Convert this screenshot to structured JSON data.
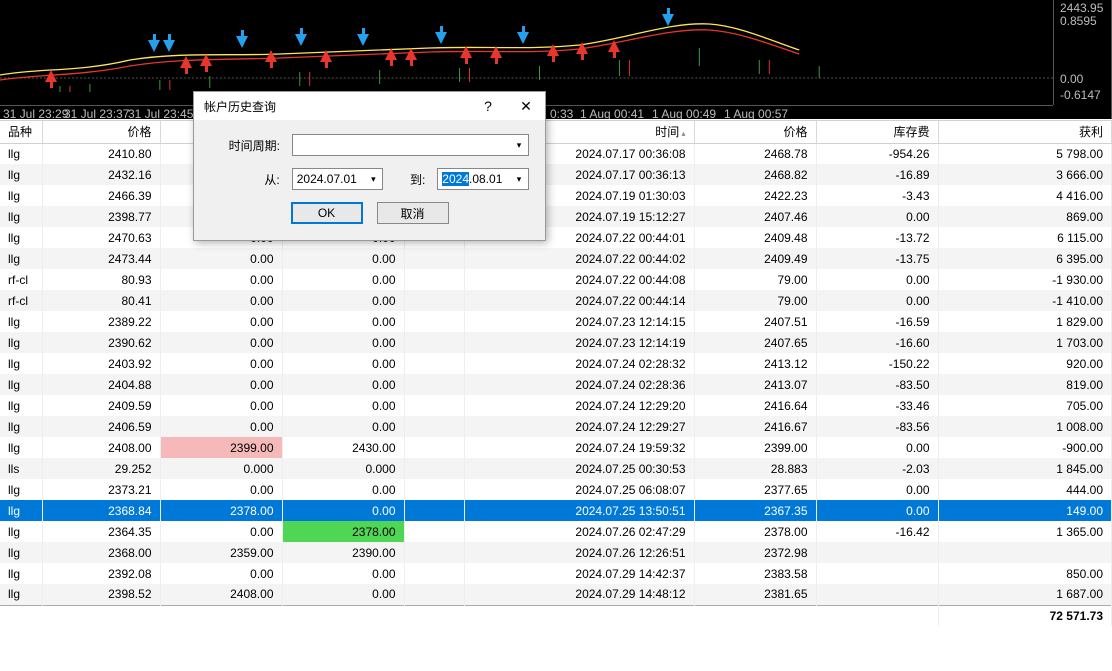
{
  "chart": {
    "scale": [
      "2443.95",
      "0.8595",
      "0.00",
      "-0.6147"
    ],
    "tlabels": [
      "31 Jul 23:29",
      "31 Jul 23:37",
      "31 Jul 23:45",
      "0:33",
      "1 Aug 00:41",
      "1 Aug 00:49",
      "1 Aug 00:57"
    ]
  },
  "dialog": {
    "title": "帐户历史查询",
    "period_label": "时间周期:",
    "from_label": "从:",
    "to_label": "到:",
    "from": "2024.07.01",
    "to": "2024.08.01",
    "to_sel": "2024",
    "ok": "OK",
    "cancel": "取消"
  },
  "grid": {
    "headers": [
      "品种",
      "价格",
      "",
      "",
      "",
      "时间",
      "价格",
      "库存费",
      "获利"
    ],
    "rows": [
      {
        "c": [
          "llg",
          "2410.80",
          "",
          "",
          "",
          "2024.07.17 00:36:08",
          "2468.78",
          "-954.26",
          "5 798.00"
        ]
      },
      {
        "c": [
          "llg",
          "2432.16",
          "",
          "",
          "",
          "2024.07.17 00:36:13",
          "2468.82",
          "-16.89",
          "3 666.00"
        ]
      },
      {
        "c": [
          "llg",
          "2466.39",
          "",
          "",
          "",
          "2024.07.19 01:30:03",
          "2422.23",
          "-3.43",
          "4 416.00"
        ]
      },
      {
        "c": [
          "llg",
          "2398.77",
          "",
          "",
          "",
          "2024.07.19 15:12:27",
          "2407.46",
          "0.00",
          "869.00"
        ]
      },
      {
        "c": [
          "llg",
          "2470.63",
          "0.00",
          "0.00",
          "",
          "2024.07.22 00:44:01",
          "2409.48",
          "-13.72",
          "6 115.00"
        ]
      },
      {
        "c": [
          "llg",
          "2473.44",
          "0.00",
          "0.00",
          "",
          "2024.07.22 00:44:02",
          "2409.49",
          "-13.75",
          "6 395.00"
        ]
      },
      {
        "c": [
          "rf-cl",
          "80.93",
          "0.00",
          "0.00",
          "",
          "2024.07.22 00:44:08",
          "79.00",
          "0.00",
          "-1 930.00"
        ]
      },
      {
        "c": [
          "rf-cl",
          "80.41",
          "0.00",
          "0.00",
          "",
          "2024.07.22 00:44:14",
          "79.00",
          "0.00",
          "-1 410.00"
        ]
      },
      {
        "c": [
          "llg",
          "2389.22",
          "0.00",
          "0.00",
          "",
          "2024.07.23 12:14:15",
          "2407.51",
          "-16.59",
          "1 829.00"
        ]
      },
      {
        "c": [
          "llg",
          "2390.62",
          "0.00",
          "0.00",
          "",
          "2024.07.23 12:14:19",
          "2407.65",
          "-16.60",
          "1 703.00"
        ]
      },
      {
        "c": [
          "llg",
          "2403.92",
          "0.00",
          "0.00",
          "",
          "2024.07.24 02:28:32",
          "2413.12",
          "-150.22",
          "920.00"
        ]
      },
      {
        "c": [
          "llg",
          "2404.88",
          "0.00",
          "0.00",
          "",
          "2024.07.24 02:28:36",
          "2413.07",
          "-83.50",
          "819.00"
        ]
      },
      {
        "c": [
          "llg",
          "2409.59",
          "0.00",
          "0.00",
          "",
          "2024.07.24 12:29:20",
          "2416.64",
          "-33.46",
          "705.00"
        ]
      },
      {
        "c": [
          "llg",
          "2406.59",
          "0.00",
          "0.00",
          "",
          "2024.07.24 12:29:27",
          "2416.67",
          "-83.56",
          "1 008.00"
        ]
      },
      {
        "c": [
          "llg",
          "2408.00",
          "2399.00",
          "2430.00",
          "",
          "2024.07.24 19:59:32",
          "2399.00",
          "0.00",
          "-900.00"
        ],
        "hl": {
          "1": "red"
        }
      },
      {
        "c": [
          "lls",
          "29.252",
          "0.000",
          "0.000",
          "",
          "2024.07.25 00:30:53",
          "28.883",
          "-2.03",
          "1 845.00"
        ]
      },
      {
        "c": [
          "llg",
          "2373.21",
          "0.00",
          "0.00",
          "",
          "2024.07.25 06:08:07",
          "2377.65",
          "0.00",
          "444.00"
        ]
      },
      {
        "c": [
          "llg",
          "2368.84",
          "2378.00",
          "0.00",
          "",
          "2024.07.25 13:50:51",
          "2367.35",
          "0.00",
          "149.00"
        ],
        "sel": true
      },
      {
        "c": [
          "llg",
          "2364.35",
          "0.00",
          "2378.00",
          "",
          "2024.07.26 02:47:29",
          "2378.00",
          "-16.42",
          "1 365.00"
        ],
        "hl": {
          "2": "green"
        }
      },
      {
        "c": [
          "llg",
          "2368.00",
          "2359.00",
          "2390.00",
          "",
          "2024.07.26 12:26:51",
          "2372.98",
          "",
          ""
        ]
      },
      {
        "c": [
          "llg",
          "2392.08",
          "0.00",
          "0.00",
          "",
          "2024.07.29 14:42:37",
          "2383.58",
          "",
          "850.00"
        ]
      },
      {
        "c": [
          "llg",
          "2398.52",
          "2408.00",
          "0.00",
          "",
          "2024.07.29 14:48:12",
          "2381.65",
          "",
          "1 687.00"
        ]
      }
    ],
    "total": "72 571.73"
  }
}
